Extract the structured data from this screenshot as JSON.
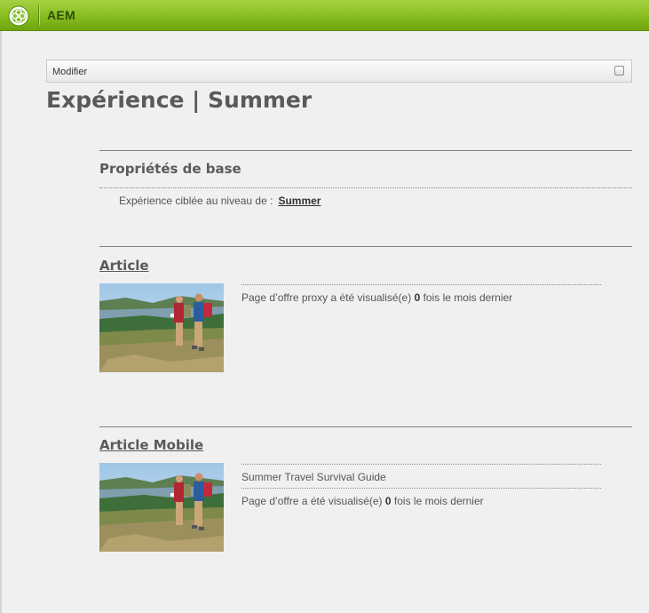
{
  "app": {
    "name": "AEM",
    "logo_icon": "aem-logo-icon"
  },
  "toolbar": {
    "modify_label": "Modifier"
  },
  "page": {
    "title": "Expérience | Summer"
  },
  "basic_properties": {
    "heading": "Propriétés de base",
    "target_label": "Expérience ciblée au niveau de :",
    "target_value": "Summer"
  },
  "offers": [
    {
      "title": "Article",
      "thumbnail_icon": "hikers-photo",
      "views_prefix": "Page d’offre proxy a été visualisé(e)",
      "views_count": "0",
      "views_suffix": "fois le mois dernier"
    },
    {
      "title": "Article Mobile",
      "thumbnail_icon": "hikers-photo",
      "subtitle": "Summer Travel Survival Guide",
      "views_prefix": "Page d’offre a été visualisé(e)",
      "views_count": "0",
      "views_suffix": "fois le mois dernier"
    }
  ],
  "colors": {
    "topbar": "#86bd1e",
    "background": "#f0f0f0",
    "text": "#555555"
  }
}
